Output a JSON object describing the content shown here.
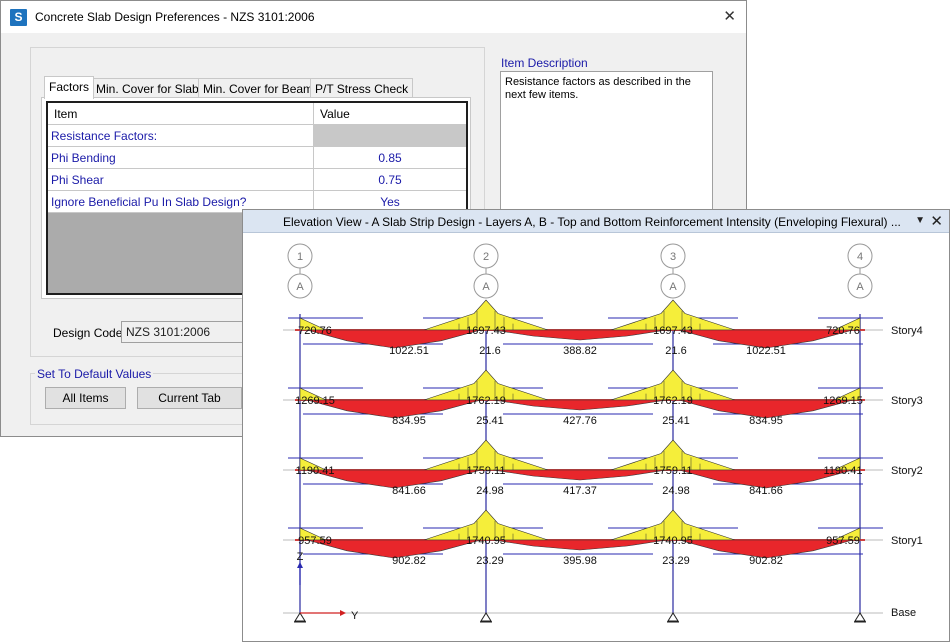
{
  "dialog": {
    "title": "Concrete Slab Design Preferences - NZS 3101:2006",
    "close_glyph": "✕",
    "tabs": [
      "Factors",
      "Min. Cover for Slabs",
      "Min. Cover for Beams",
      "P/T Stress Check"
    ],
    "grid": {
      "headers": [
        "Item",
        "Value"
      ],
      "rows": [
        {
          "item": "Resistance Factors:",
          "value": ""
        },
        {
          "item": "Phi Bending",
          "value": "0.85"
        },
        {
          "item": "Phi Shear",
          "value": "0.75"
        },
        {
          "item": "Ignore Beneficial Pu In Slab Design?",
          "value": "Yes"
        }
      ]
    },
    "design_code_label": "Design Code",
    "design_code_value": "NZS 3101:2006",
    "defaults_caption": "Set To Default Values",
    "buttons": {
      "all_items": "All Items",
      "current_tab": "Current Tab"
    },
    "item_description_caption": "Item Description",
    "item_description_text": "Resistance factors as described in the next few items."
  },
  "elevation": {
    "title": "Elevation View - A  Slab Strip Design - Layers A, B - Top and Bottom Reinforcement Intensity (Enveloping Flexural) ...",
    "menu_glyph": "▼",
    "close_glyph": "✕",
    "gridlines": [
      "1",
      "2",
      "3",
      "4"
    ],
    "row_label": "A",
    "axis_labels": {
      "z": "Z",
      "y": "Y"
    },
    "base_label": "Base",
    "stories": [
      {
        "name": "Story4",
        "top_end": "720.76",
        "top_mid": "1697.43",
        "bot_side": "1022.51",
        "bot_mid": "388.82",
        "near_col": "21.6"
      },
      {
        "name": "Story3",
        "top_end": "1269.15",
        "top_mid": "1762.19",
        "bot_side": "834.95",
        "bot_mid": "427.76",
        "near_col": "25.41"
      },
      {
        "name": "Story2",
        "top_end": "1190.41",
        "top_mid": "1759.11",
        "bot_side": "841.66",
        "bot_mid": "417.37",
        "near_col": "24.98"
      },
      {
        "name": "Story1",
        "top_end": "957.59",
        "top_mid": "1740.95",
        "bot_side": "902.82",
        "bot_mid": "395.98",
        "near_col": "23.29"
      }
    ],
    "colors": {
      "top": "#f5ee3a",
      "bottom": "#e8262b",
      "outline": "#333333",
      "column": "#3a3aa8"
    }
  }
}
